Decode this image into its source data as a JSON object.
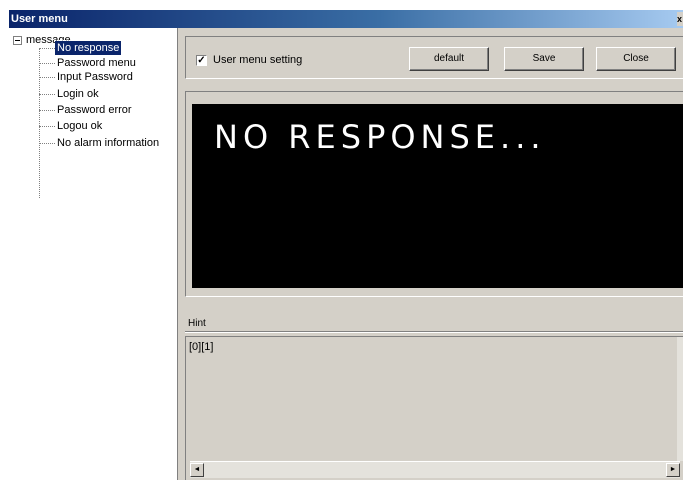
{
  "window": {
    "title": "User menu",
    "close_glyph": "x"
  },
  "tree": {
    "root_label": "message",
    "items": [
      {
        "label": "No response",
        "selected": true
      },
      {
        "label": "Password menu"
      },
      {
        "label": "Input Password"
      },
      {
        "label": "Login ok"
      },
      {
        "label": "Password error"
      },
      {
        "label": "Logou ok"
      },
      {
        "label": "No alarm information"
      }
    ]
  },
  "toolbar": {
    "checkbox_checked": true,
    "checkbox_mark": "✓",
    "checkbox_label": "User menu setting",
    "default_label": "default",
    "save_label": "Save",
    "close_label": "Close"
  },
  "preview": {
    "message": "NO RESPONSE..."
  },
  "hint": {
    "label": "Hint",
    "text": "[0][1]"
  },
  "scroll": {
    "left_glyph": "◄",
    "right_glyph": "►"
  }
}
